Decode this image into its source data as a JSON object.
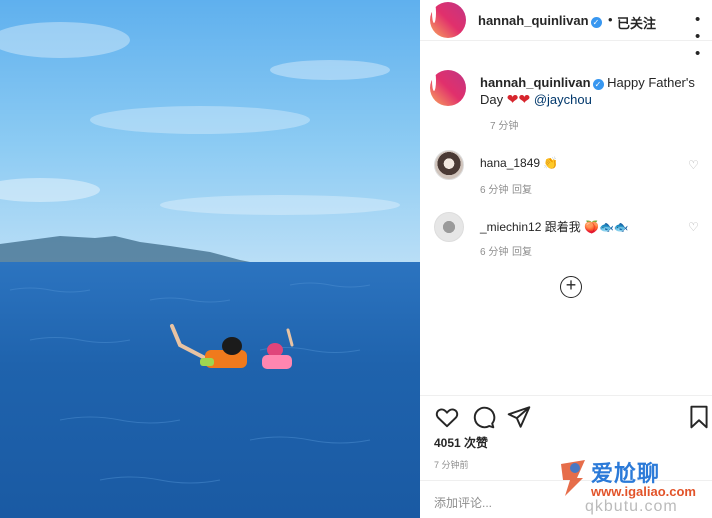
{
  "post": {
    "author": "hannah_quinlivan",
    "separator": "•",
    "follow_label": "已关注",
    "more_icon": "more-options-icon"
  },
  "caption": {
    "author": "hannah_quinlivan",
    "text": " Happy Father's Day ",
    "hearts": "❤❤",
    "mention": "@jaychou",
    "time": "7 分钟"
  },
  "comments": [
    {
      "user": "hana_1849",
      "text": "👏",
      "time": "6 分钟",
      "reply": "回复"
    },
    {
      "user": "_miechin12",
      "text": "跟着我 🍑🐟🐟",
      "time": "6 分钟",
      "reply": "回复"
    }
  ],
  "load_more_symbol": "+",
  "likes": "4051 次赞",
  "post_time": "7 分钟前",
  "add_comment_placeholder": "添加评论...",
  "watermark": {
    "line1": "爱尬聊",
    "line2": "www.igaliao.com",
    "line3": "qkbutu.com"
  },
  "colors": {
    "verified": "#3897f0",
    "sea": "#1d5fa8",
    "sky": "#7fc4f2",
    "watermark_blue": "#2b7ad8",
    "watermark_orange": "#e2542a"
  }
}
